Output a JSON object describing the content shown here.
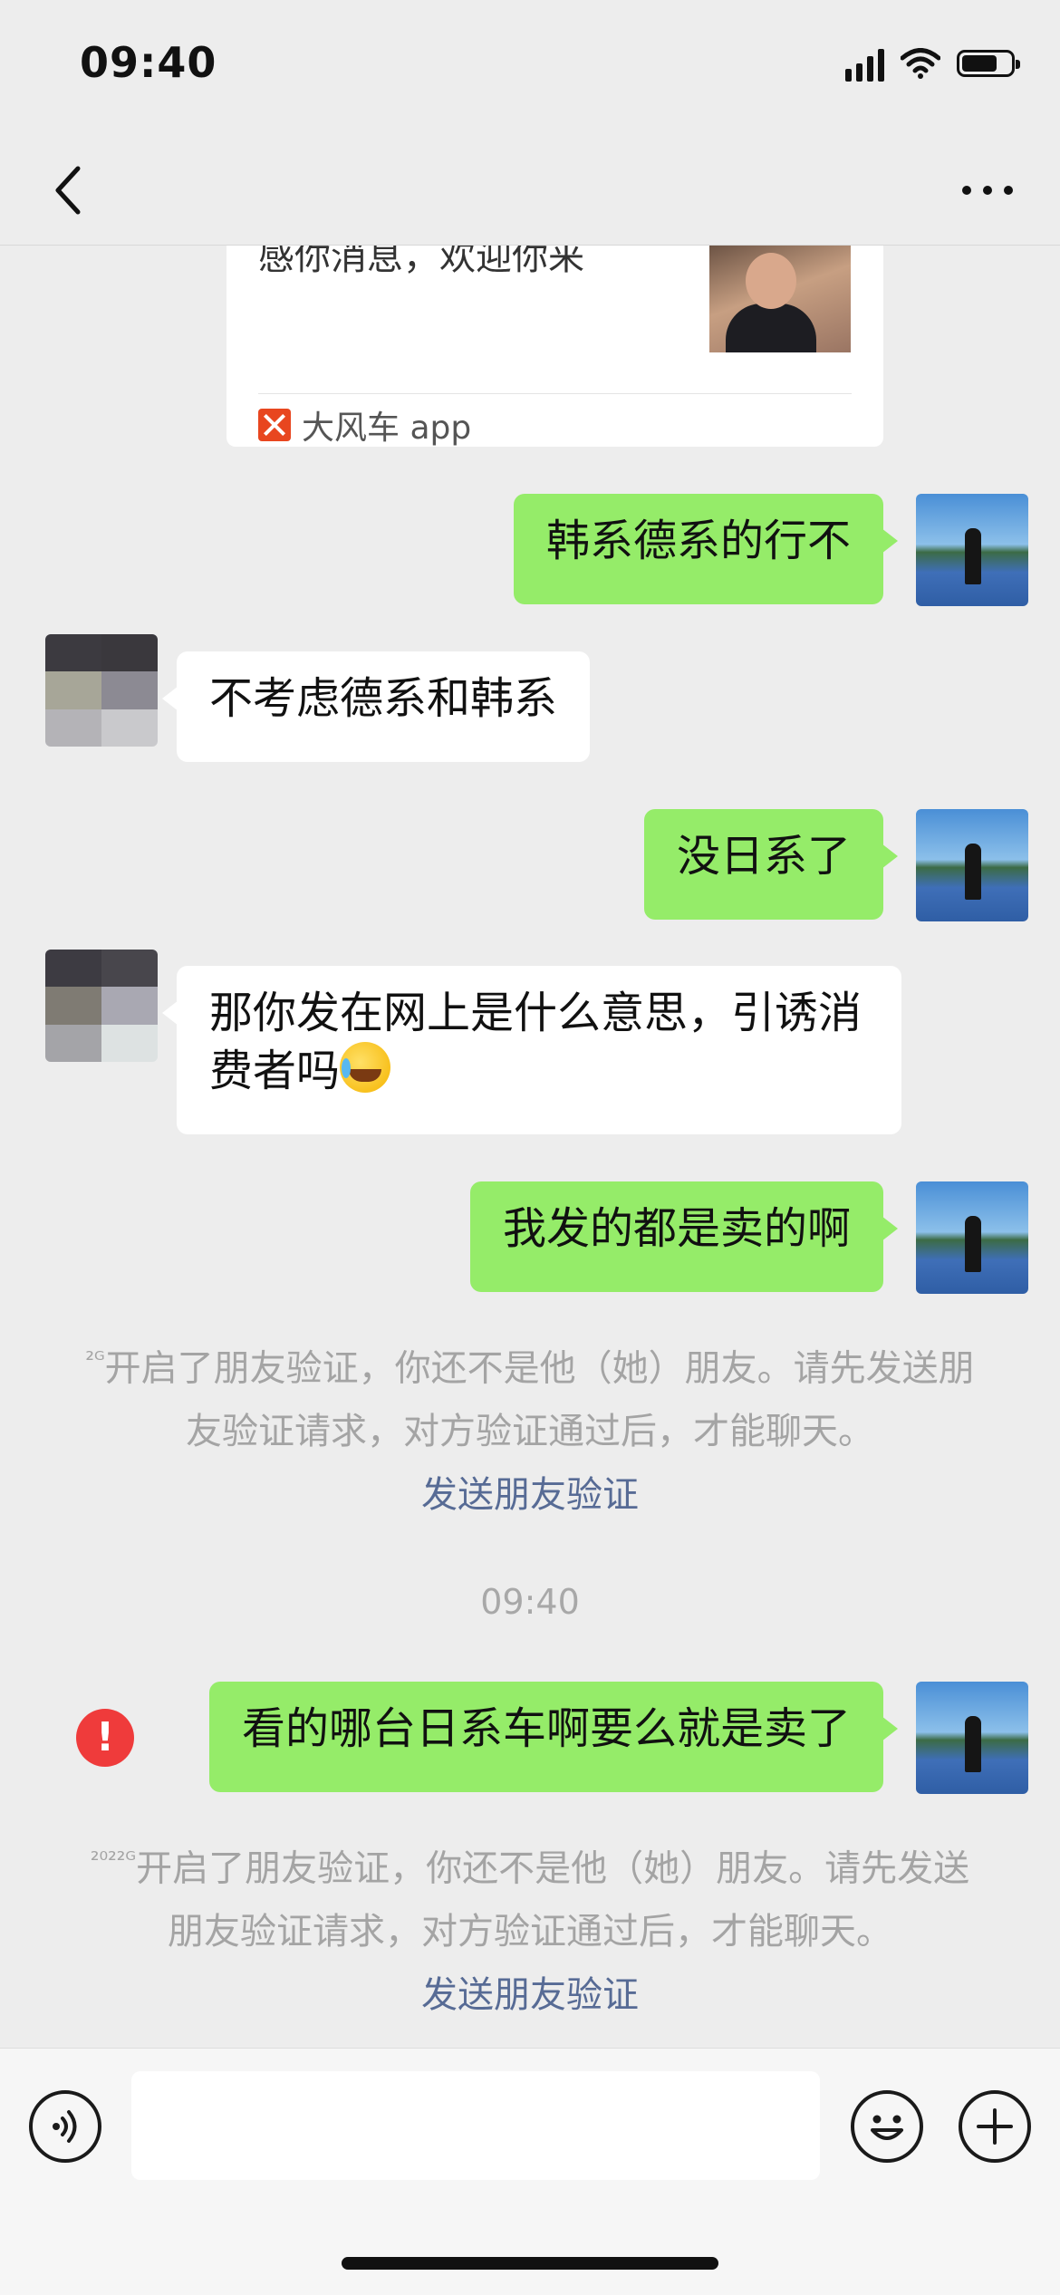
{
  "status_bar": {
    "time": "09:40"
  },
  "nav_bar": {
    "back_icon": "chevron-left-icon",
    "more_icon": "more-dots-icon"
  },
  "link_card": {
    "text": "感你消息，欢迎你来",
    "source": "大风车 app"
  },
  "messages": [
    {
      "side": "out",
      "text": "韩系德系的行不"
    },
    {
      "side": "in",
      "text": "不考虑德系和韩系"
    },
    {
      "side": "out",
      "text": "没日系了"
    },
    {
      "side": "in",
      "text": "那你发在网上是什么意思，引诱消费者吗"
    },
    {
      "side": "out",
      "text": "我发的都是卖的啊"
    },
    {
      "side": "out",
      "text": "看的哪台日系车啊要么就是卖了",
      "failed": true
    }
  ],
  "system_notices": [
    {
      "prefix": "²ᴳ",
      "text": "开启了朋友验证，你还不是他（她）朋友。请先发送朋友验证请求，对方验证通过后，才能聊天。",
      "link": "发送朋友验证"
    },
    {
      "prefix": "²⁰²²ᴳ",
      "text": "开启了朋友验证，你还不是他（她）朋友。请先发送朋友验证请求，对方验证通过后，才能聊天。",
      "link": "发送朋友验证"
    }
  ],
  "timestamp": "09:40",
  "error_mark": "!",
  "input_bar": {
    "placeholder": "",
    "voice_icon": "voice-icon",
    "emoji_icon": "emoji-icon",
    "plus_icon": "plus-icon"
  }
}
